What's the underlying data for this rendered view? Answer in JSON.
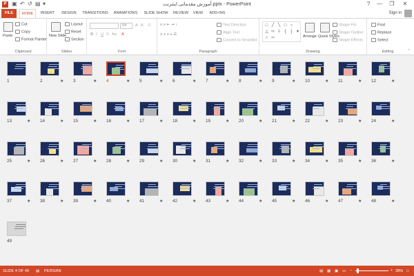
{
  "app": {
    "title": "آموزش مقدماتی اینترنت.pptx - PowerPoint",
    "icon_label": "P"
  },
  "window": {
    "min": "—",
    "restore": "❐",
    "close": "✕",
    "help": "?"
  },
  "tabs": [
    "FILE",
    "HOME",
    "INSERT",
    "DESIGN",
    "TRANSITIONS",
    "ANIMATIONS",
    "SLIDE SHOW",
    "REVIEW",
    "VIEW",
    "ADD-INS"
  ],
  "active_tab": "HOME",
  "sign_in": "Sign in",
  "ribbon": {
    "clipboard": {
      "label": "Clipboard",
      "paste": "Paste",
      "cut": "Cut",
      "copy": "Copy",
      "format_painter": "Format Painter"
    },
    "slides": {
      "label": "Slides",
      "new_slide": "New Slide",
      "layout": "Layout",
      "reset": "Reset",
      "section": "Section"
    },
    "font": {
      "label": "Font",
      "size": "54",
      "bold": "B",
      "italic": "I",
      "underline": "U",
      "strike": "S",
      "grow": "A",
      "shrink": "A",
      "color": "A",
      "case": "Aa"
    },
    "paragraph": {
      "label": "Paragraph",
      "text_direction": "Text Direction",
      "align_text": "Align Text",
      "convert_smartart": "Convert to SmartArt"
    },
    "drawing": {
      "label": "Drawing",
      "arrange": "Arrange",
      "quick_styles": "Quick Styles",
      "shape_fill": "Shape Fill",
      "shape_outline": "Shape Outline",
      "shape_effects": "Shape Effects"
    },
    "editing": {
      "label": "Editing",
      "find": "Find",
      "replace": "Replace",
      "select": "Select"
    }
  },
  "slides": {
    "count": 49,
    "selected": 4,
    "star": "★",
    "labels": [
      "1",
      "2",
      "3",
      "4",
      "5",
      "6",
      "7",
      "8",
      "9",
      "10",
      "11",
      "12",
      "13",
      "14",
      "15",
      "16",
      "17",
      "18",
      "19",
      "20",
      "21",
      "22",
      "23",
      "24",
      "25",
      "26",
      "27",
      "28",
      "29",
      "30",
      "31",
      "32",
      "33",
      "34",
      "35",
      "36",
      "37",
      "38",
      "39",
      "40",
      "41",
      "42",
      "43",
      "44",
      "45",
      "46",
      "47",
      "48",
      "49"
    ]
  },
  "status": {
    "slide_info": "SLIDE 4 OF 49",
    "language": "PERSIAN",
    "zoom": "38%"
  },
  "colors": {
    "accent": "#d24726",
    "slide_bg": "#1b2c5c",
    "sorter_bg": "#f1f1f1"
  }
}
